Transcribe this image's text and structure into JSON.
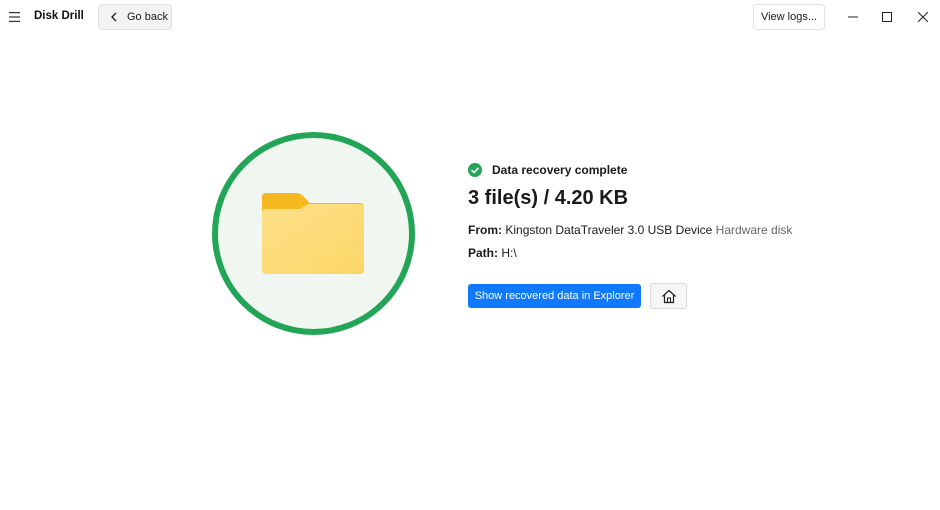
{
  "app": {
    "title": "Disk Drill",
    "menu_icon": "hamburger-icon"
  },
  "toolbar": {
    "go_back_label": "Go back",
    "view_logs_label": "View logs..."
  },
  "window_controls": [
    "minimize-icon",
    "maximize-icon",
    "close-icon"
  ],
  "result": {
    "status": "Data recovery complete",
    "summary": "3 file(s) / 4.20 KB",
    "from_label": "From:",
    "from_device": "Kingston DataTraveler 3.0 USB Device",
    "from_type": "Hardware disk",
    "path_label": "Path:",
    "path_value": "H:\\"
  },
  "actions": {
    "show_in_explorer_label": "Show recovered data in Explorer",
    "home_icon": "home-icon"
  },
  "colors": {
    "accent": "#0f7aff",
    "success": "#22a557",
    "circle_fill": "#f0f7f1",
    "folder": "#fbbf24"
  }
}
